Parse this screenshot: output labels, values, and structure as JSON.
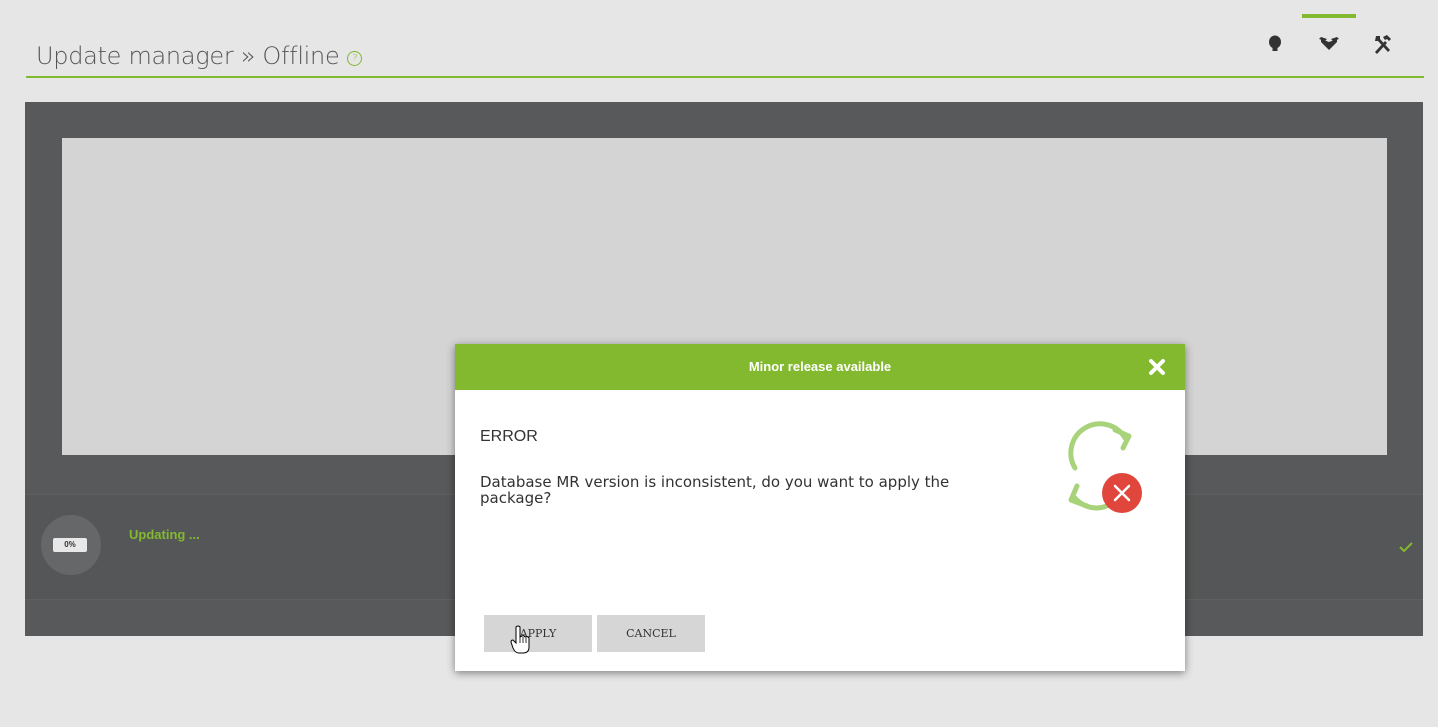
{
  "header": {
    "title": "Update manager » Offline",
    "help_icon": "?",
    "icons": [
      {
        "name": "lightbulb-icon",
        "active": false
      },
      {
        "name": "package-icon",
        "active": true
      },
      {
        "name": "tools-icon",
        "active": false
      }
    ]
  },
  "progress": {
    "percent_label": "0%",
    "status_label": "Updating ...",
    "percent": 0
  },
  "modal": {
    "title": "Minor release available",
    "error_title": "ERROR",
    "message": "Database MR version is inconsistent, do you want to apply the package?",
    "apply_label": "APPLY",
    "cancel_label": "CANCEL"
  },
  "colors": {
    "accent": "#82b92e",
    "panel": "#58595a",
    "error": "#e0463c"
  }
}
